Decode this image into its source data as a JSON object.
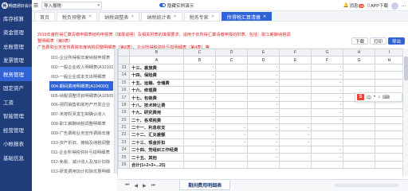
{
  "leftnav": {
    "logo_text": "畅捷通好会计",
    "items": [
      {
        "label": "库存核算"
      },
      {
        "label": "资金管理"
      },
      {
        "label": "总账管理"
      },
      {
        "label": "发票管理"
      },
      {
        "label": "税务管理"
      },
      {
        "label": "固定资产"
      },
      {
        "label": "工资"
      },
      {
        "label": "智能管理"
      },
      {
        "label": "经营管理"
      },
      {
        "label": "小帐报表"
      },
      {
        "label": "基础信息"
      },
      {
        "label": ""
      },
      {
        "label": ""
      }
    ],
    "active_index": 4
  },
  "topbar": {
    "company": "导入报税",
    "toggle_label": "隐藏实例演示",
    "right": [
      {
        "label": "消息",
        "badge": "99"
      },
      {
        "label": "APP下载"
      },
      {
        "label": "..."
      }
    ]
  },
  "tabs": [
    {
      "label": "首页",
      "closable": false
    },
    {
      "label": "税负预警表",
      "closable": true
    },
    {
      "label": "纳税调整表",
      "closable": true
    },
    {
      "label": "纳税统计表",
      "closable": true
    },
    {
      "label": "税务专家",
      "closable": true
    },
    {
      "label": "所得税汇算清缴",
      "closable": true
    }
  ],
  "active_tab": 5,
  "notice": {
    "line1": "2019年度所得汇算清缴申报表结构申报表（填报说明）及相关附表的填报要求，适用于年所得汇算清缴申报的附表，包括：职工薪酬纳税调整明细表（第9表）",
    "line2": "广告费和业务宣传费跨年度纳税调整明细表（第8表）、企业所得税弥补亏损明细表（第4表）等"
  },
  "toolbar": {
    "buttons": [
      {
        "label": "下载",
        "primary": false
      },
      {
        "label": "打印",
        "primary": false
      },
      {
        "label": "导出",
        "primary": true
      }
    ]
  },
  "tree": {
    "items": [
      "001-企业所得税年度纳税申报表",
      "002-一般企业收入明细表(A101010)",
      "003-一般企业成本支出明细表",
      "004-期间费用明细表(A104000)",
      "005-纳税调整项目明细表(A105000)",
      "006-视同销售和房地产开发企业",
      "007-未按权责发生制确认收入",
      "008-职工薪酬纳税调整明细表",
      "009-广告费和业务宣传费跨年度",
      "010-资产折旧、摊销及纳税调整",
      "011-企业所得税弥补亏损明细表",
      "012-免税、减计收入及加计扣除",
      "013-研发费用加计扣除优惠明细",
      "014-减免所得税优惠明细表"
    ],
    "active_index": 3
  },
  "sheet": {
    "columns": [
      "",
      "B",
      "C",
      "D",
      "E",
      "F",
      "G",
      "H",
      "I"
    ],
    "rows": [
      {
        "rn": "13",
        "label": "十三、差旅费",
        "dots": [
          1,
          0,
          1,
          0,
          1,
          0,
          0,
          0
        ]
      },
      {
        "rn": "14",
        "label": "十四、保险费",
        "dots": [
          1,
          0,
          1,
          0,
          1,
          0,
          0,
          0
        ]
      },
      {
        "rn": "15",
        "label": "十五、运输、仓储费",
        "dots": [
          1,
          0,
          1,
          0,
          1,
          0,
          0,
          0
        ]
      },
      {
        "rn": "16",
        "label": "十六、修理费",
        "dots": [
          1,
          0,
          1,
          0,
          1,
          0,
          0,
          0
        ]
      },
      {
        "rn": "17",
        "label": "十七、包装费",
        "dots": [
          1,
          0,
          1,
          0,
          1,
          0,
          0,
          0
        ]
      },
      {
        "rn": "18",
        "label": "十八、技术转让费",
        "dots": [
          1,
          0,
          1,
          0,
          1,
          0,
          0,
          0
        ]
      },
      {
        "rn": "19",
        "label": "十九、研究费用",
        "dots": [
          1,
          0,
          1,
          0,
          1,
          0,
          0,
          0
        ]
      },
      {
        "rn": "20",
        "label": "二十、各项税费",
        "dots": [
          1,
          0,
          1,
          0,
          1,
          0,
          0,
          0
        ]
      },
      {
        "rn": "21",
        "label": "二十一、利息收支",
        "dots": [
          1,
          1,
          1,
          1,
          0,
          0,
          0,
          0
        ]
      },
      {
        "rn": "22",
        "label": "二十二、汇兑差额",
        "dots": [
          1,
          1,
          1,
          1,
          0,
          0,
          0,
          0
        ]
      },
      {
        "rn": "23",
        "label": "二十三、现金折扣",
        "dots": [
          1,
          1,
          1,
          1,
          0,
          0,
          0,
          0
        ]
      },
      {
        "rn": "24",
        "label": "二十四、党组织工作经费",
        "dots": [
          1,
          0,
          1,
          0,
          1,
          0,
          0,
          0
        ]
      },
      {
        "rn": "25",
        "label": "二十五、其他",
        "dots": [
          1,
          0,
          1,
          0,
          1,
          0,
          0,
          0
        ]
      },
      {
        "rn": "26",
        "label": "合计(1+2+3+...25)",
        "dots": [
          0,
          0,
          0,
          0,
          0,
          0,
          0,
          0
        ]
      }
    ],
    "first_header_row": [
      "",
      "A",
      "B",
      "C",
      "D",
      "E",
      "F",
      "G",
      "H"
    ]
  },
  "sheet_tab": {
    "label": "期间费用明细表"
  },
  "ime": {
    "brand": "S",
    "glyphs": [
      "中",
      "•",
      "♪",
      "⌨"
    ]
  },
  "colors": {
    "nav": "#1f3d7a",
    "accent": "#2f63d6",
    "notice": "#e0262b"
  }
}
